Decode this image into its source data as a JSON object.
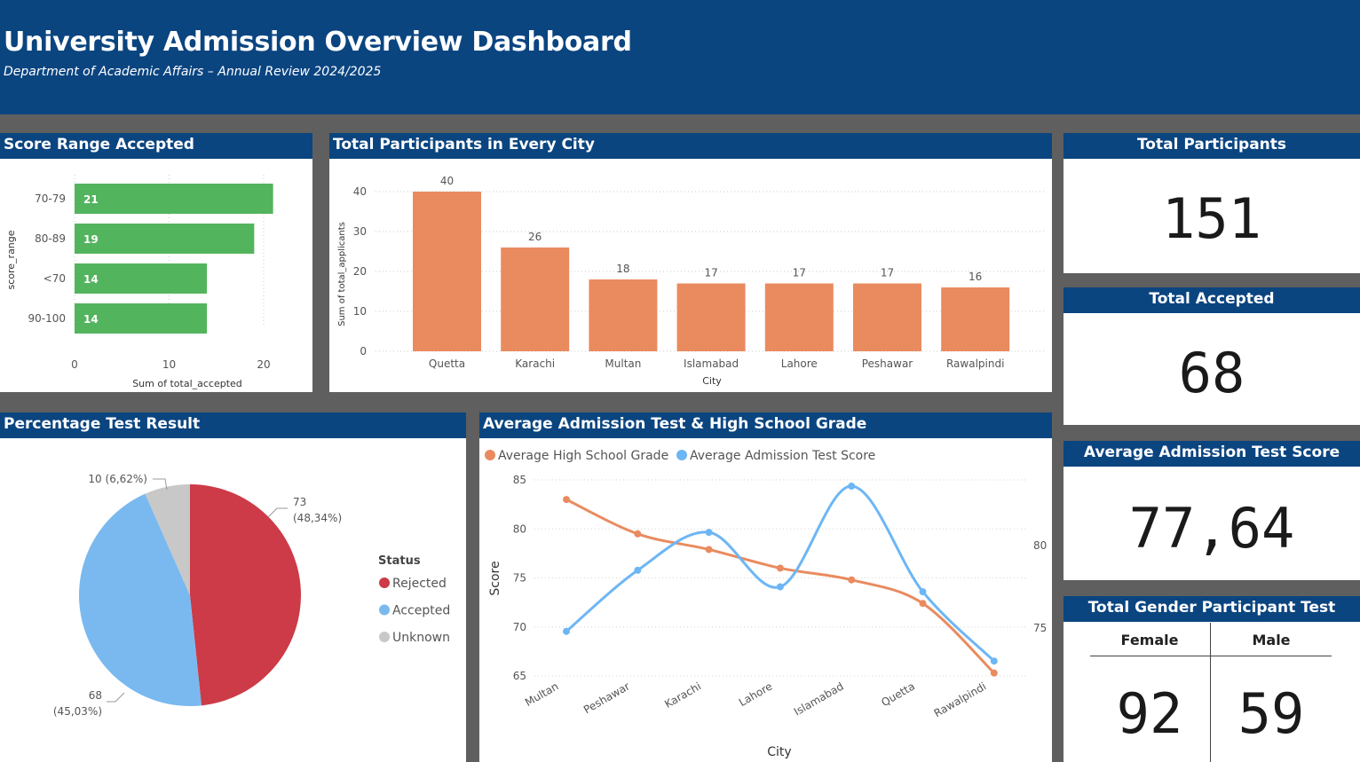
{
  "header": {
    "title": "University Admission Overview Dashboard",
    "subtitle": "Department of Academic Affairs – Annual Review 2024/2025"
  },
  "panels": {
    "score_range_title": "Score Range Accepted",
    "participants_city_title": "Total Participants in Every City",
    "total_participants_title": "Total Participants",
    "total_accepted_title": "Total Accepted",
    "avg_test_title": "Average Admission Test Score",
    "gender_title": "Total Gender Participant Test",
    "pct_result_title": "Percentage Test Result",
    "avg_line_title": "Average Admission Test & High School Grade"
  },
  "kpis": {
    "total_participants": "151",
    "total_accepted": "68",
    "avg_test_score": "77,64"
  },
  "gender": {
    "female_label": "Female",
    "male_label": "Male",
    "female_value": "92",
    "male_value": "59"
  },
  "colors": {
    "header": "#0b4580",
    "bar_green": "#53b45e",
    "bar_orange": "#e98b5f",
    "rejected": "#cc3b47",
    "accepted": "#7ab9ef",
    "unknown": "#c8c8c8",
    "line_orange": "#e98b5f",
    "line_blue": "#6db6f5"
  },
  "chart_data": [
    {
      "type": "bar",
      "orientation": "horizontal",
      "title": "Score Range Accepted",
      "categories": [
        "70-79",
        "80-89",
        "<70",
        "90-100"
      ],
      "values": [
        21,
        19,
        14,
        14
      ],
      "data_labels": [
        "21",
        "19",
        "14",
        "14"
      ],
      "xlabel": "Sum of total_accepted",
      "ylabel": "score_range",
      "xticks": [
        "0",
        "10",
        "20"
      ],
      "xlim": [
        0,
        23
      ],
      "grid": true
    },
    {
      "type": "bar",
      "title": "Total Participants in Every City",
      "categories": [
        "Quetta",
        "Karachi",
        "Multan",
        "Islamabad",
        "Lahore",
        "Peshawar",
        "Rawalpindi"
      ],
      "values": [
        40,
        26,
        18,
        17,
        17,
        17,
        16
      ],
      "data_labels": [
        "40",
        "26",
        "18",
        "17",
        "17",
        "17",
        "16"
      ],
      "xlabel": "City",
      "ylabel": "Sum of total_applicants",
      "yticks": [
        "0",
        "10",
        "20",
        "30",
        "40"
      ],
      "ylim": [
        0,
        43
      ],
      "grid": true
    },
    {
      "type": "pie",
      "title": "Percentage Test Result",
      "legend_title": "Status",
      "legend_placement": "right",
      "slices": [
        {
          "name": "Rejected",
          "value": 73,
          "label": "73",
          "pct_label": "(48,34%)"
        },
        {
          "name": "Accepted",
          "value": 68,
          "label": "68",
          "pct_label": "(45,03%)"
        },
        {
          "name": "Unknown",
          "value": 10,
          "label": "10 (6,62%)",
          "pct_label": ""
        }
      ]
    },
    {
      "type": "line",
      "title": "Average Admission Test & High School Grade",
      "categories": [
        "Multan",
        "Peshawar",
        "Karachi",
        "Lahore",
        "Islamabad",
        "Quetta",
        "Rawalpindi"
      ],
      "xlabel": "City",
      "ylabel": "Score",
      "legend_placement": "top-left",
      "series": [
        {
          "name": "Average High School Grade",
          "axis": "left",
          "values": [
            83.0,
            79.5,
            77.9,
            76.0,
            74.8,
            72.4,
            65.3
          ]
        },
        {
          "name": "Average Admission Test Score",
          "axis": "right",
          "values": [
            74.8,
            78.5,
            80.8,
            77.5,
            83.6,
            77.2,
            73.0
          ]
        }
      ],
      "left_ticks": [
        "65",
        "70",
        "75",
        "80",
        "85"
      ],
      "left_ylim": [
        65,
        85
      ],
      "right_ticks": [
        "75",
        "80"
      ],
      "right_ylim": [
        71,
        86
      ]
    }
  ]
}
